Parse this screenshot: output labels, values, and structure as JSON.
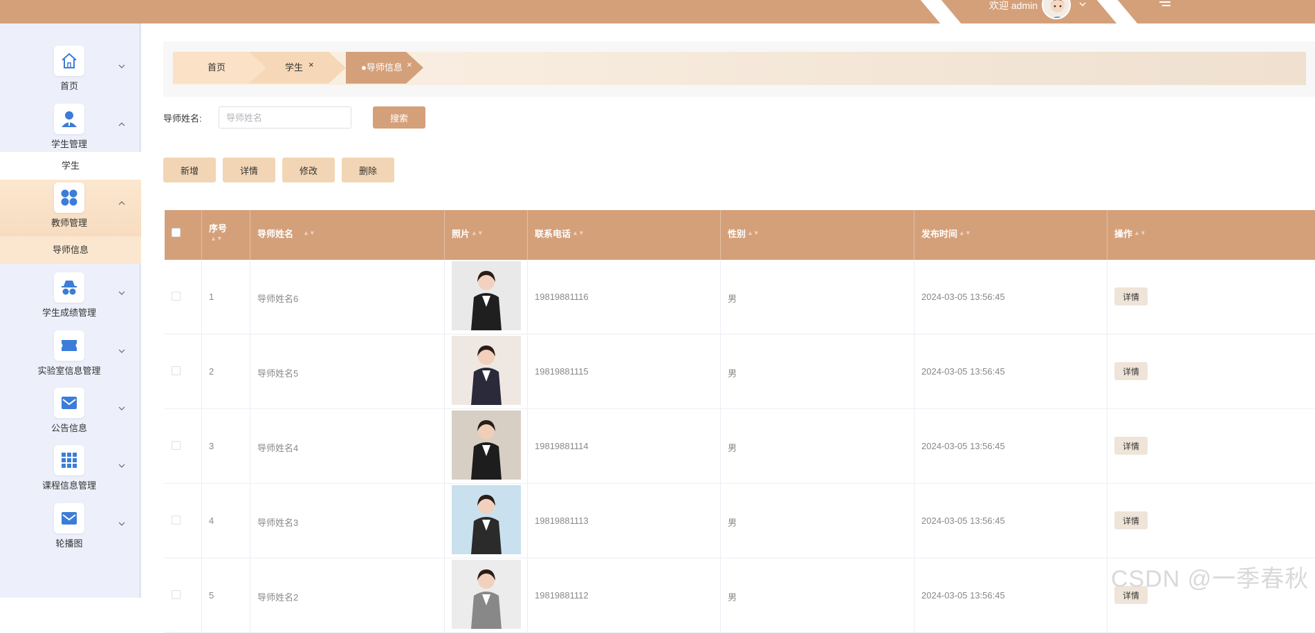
{
  "header": {
    "welcome": "欢迎 admin",
    "brand_color": "#d4a07a"
  },
  "sidebar": {
    "items": [
      {
        "label": "首页",
        "icon": "home-icon"
      },
      {
        "label": "学生管理",
        "icon": "user-icon"
      },
      {
        "label": "教师管理",
        "icon": "grid-circles-icon"
      },
      {
        "label": "学生成绩管理",
        "icon": "spy-glasses-icon"
      },
      {
        "label": "实验室信息管理",
        "icon": "ticket-icon"
      },
      {
        "label": "公告信息",
        "icon": "mail-icon"
      },
      {
        "label": "课程信息管理",
        "icon": "apps-icon"
      },
      {
        "label": "轮播图",
        "icon": "mail-icon"
      }
    ],
    "sub_students": "学生",
    "sub_teachers": "导师信息"
  },
  "tabs": [
    {
      "label": "首页"
    },
    {
      "label": "学生"
    },
    {
      "label": "●导师信息"
    }
  ],
  "search": {
    "label": "导师姓名:",
    "placeholder": "导师姓名",
    "button": "搜索"
  },
  "actions": {
    "add": "新增",
    "detail": "详情",
    "edit": "修改",
    "delete": "删除"
  },
  "table": {
    "columns": [
      "序号",
      "导师姓名",
      "照片",
      "联系电话",
      "性别",
      "发布时间",
      "操作"
    ],
    "rows": [
      {
        "index": "1",
        "name": "导师姓名6",
        "phone": "19819881116",
        "gender": "男",
        "time": "2024-03-05 13:56:45",
        "op": "详情"
      },
      {
        "index": "2",
        "name": "导师姓名5",
        "phone": "19819881115",
        "gender": "男",
        "time": "2024-03-05 13:56:45",
        "op": "详情"
      },
      {
        "index": "3",
        "name": "导师姓名4",
        "phone": "19819881114",
        "gender": "男",
        "time": "2024-03-05 13:56:45",
        "op": "详情"
      },
      {
        "index": "4",
        "name": "导师姓名3",
        "phone": "19819881113",
        "gender": "男",
        "time": "2024-03-05 13:56:45",
        "op": "详情"
      },
      {
        "index": "5",
        "name": "导师姓名2",
        "phone": "19819881112",
        "gender": "男",
        "time": "2024-03-05 13:56:45",
        "op": "详情"
      }
    ]
  },
  "watermark": "CSDN @一季春秋"
}
